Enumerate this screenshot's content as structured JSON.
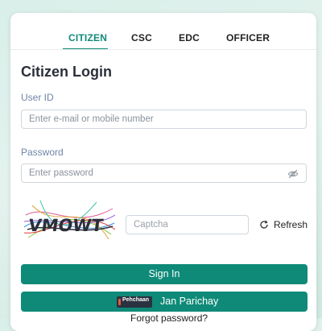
{
  "tabs": [
    {
      "label": "CITIZEN",
      "active": true
    },
    {
      "label": "CSC",
      "active": false
    },
    {
      "label": "EDC",
      "active": false
    },
    {
      "label": "OFFICER",
      "active": false
    }
  ],
  "title": "Citizen Login",
  "user_id": {
    "label": "User ID",
    "placeholder": "Enter e-mail or mobile number"
  },
  "password": {
    "label": "Password",
    "placeholder": "Enter password",
    "icon": "eye-off-icon"
  },
  "captcha": {
    "placeholder": "Captcha",
    "refresh_label": "Refresh"
  },
  "sign_in_label": "Sign In",
  "jan_parichay": {
    "label": "Jan Parichay",
    "logo_text": "Pehchaan"
  },
  "forgot_password_label": "Forgot password?",
  "colors": {
    "accent": "#0f8a78",
    "label": "#6f84a8"
  }
}
